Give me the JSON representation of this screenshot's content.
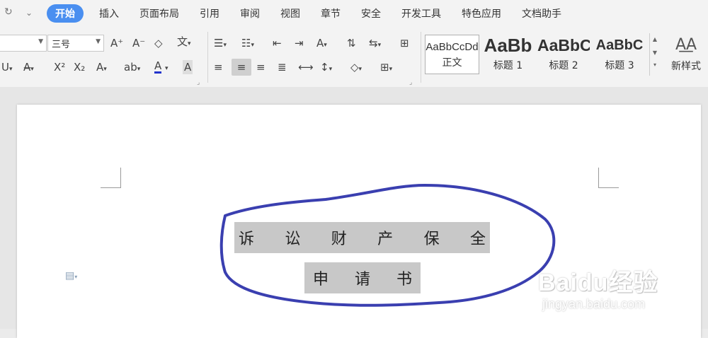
{
  "menubar": {
    "tabs": [
      "开始",
      "插入",
      "页面布局",
      "引用",
      "审阅",
      "视图",
      "章节",
      "安全",
      "开发工具",
      "特色应用",
      "文档助手"
    ],
    "redo_icon": "redo-icon",
    "more_icon": "chevron-down-icon"
  },
  "ribbon": {
    "font_size": "三号",
    "styles": [
      {
        "sample": "AaBbCcDd",
        "name": "正文"
      },
      {
        "sample": "AaBb",
        "name": "标题 1"
      },
      {
        "sample": "AaBbC",
        "name": "标题 2"
      },
      {
        "sample": "AaBbC",
        "name": "标题 3"
      }
    ],
    "new_style_label": "新样式"
  },
  "document": {
    "line1": [
      "诉",
      "讼",
      "财",
      "产",
      "保",
      "全"
    ],
    "line2": [
      "申",
      "请",
      "书"
    ]
  },
  "watermark": {
    "logo": "Baidu经验",
    "url": "jingyan.baidu.com"
  },
  "colors": {
    "active_tab": "#4a8ff0",
    "annotation": "#3a3fb0",
    "highlight": "#c8c8c8"
  }
}
